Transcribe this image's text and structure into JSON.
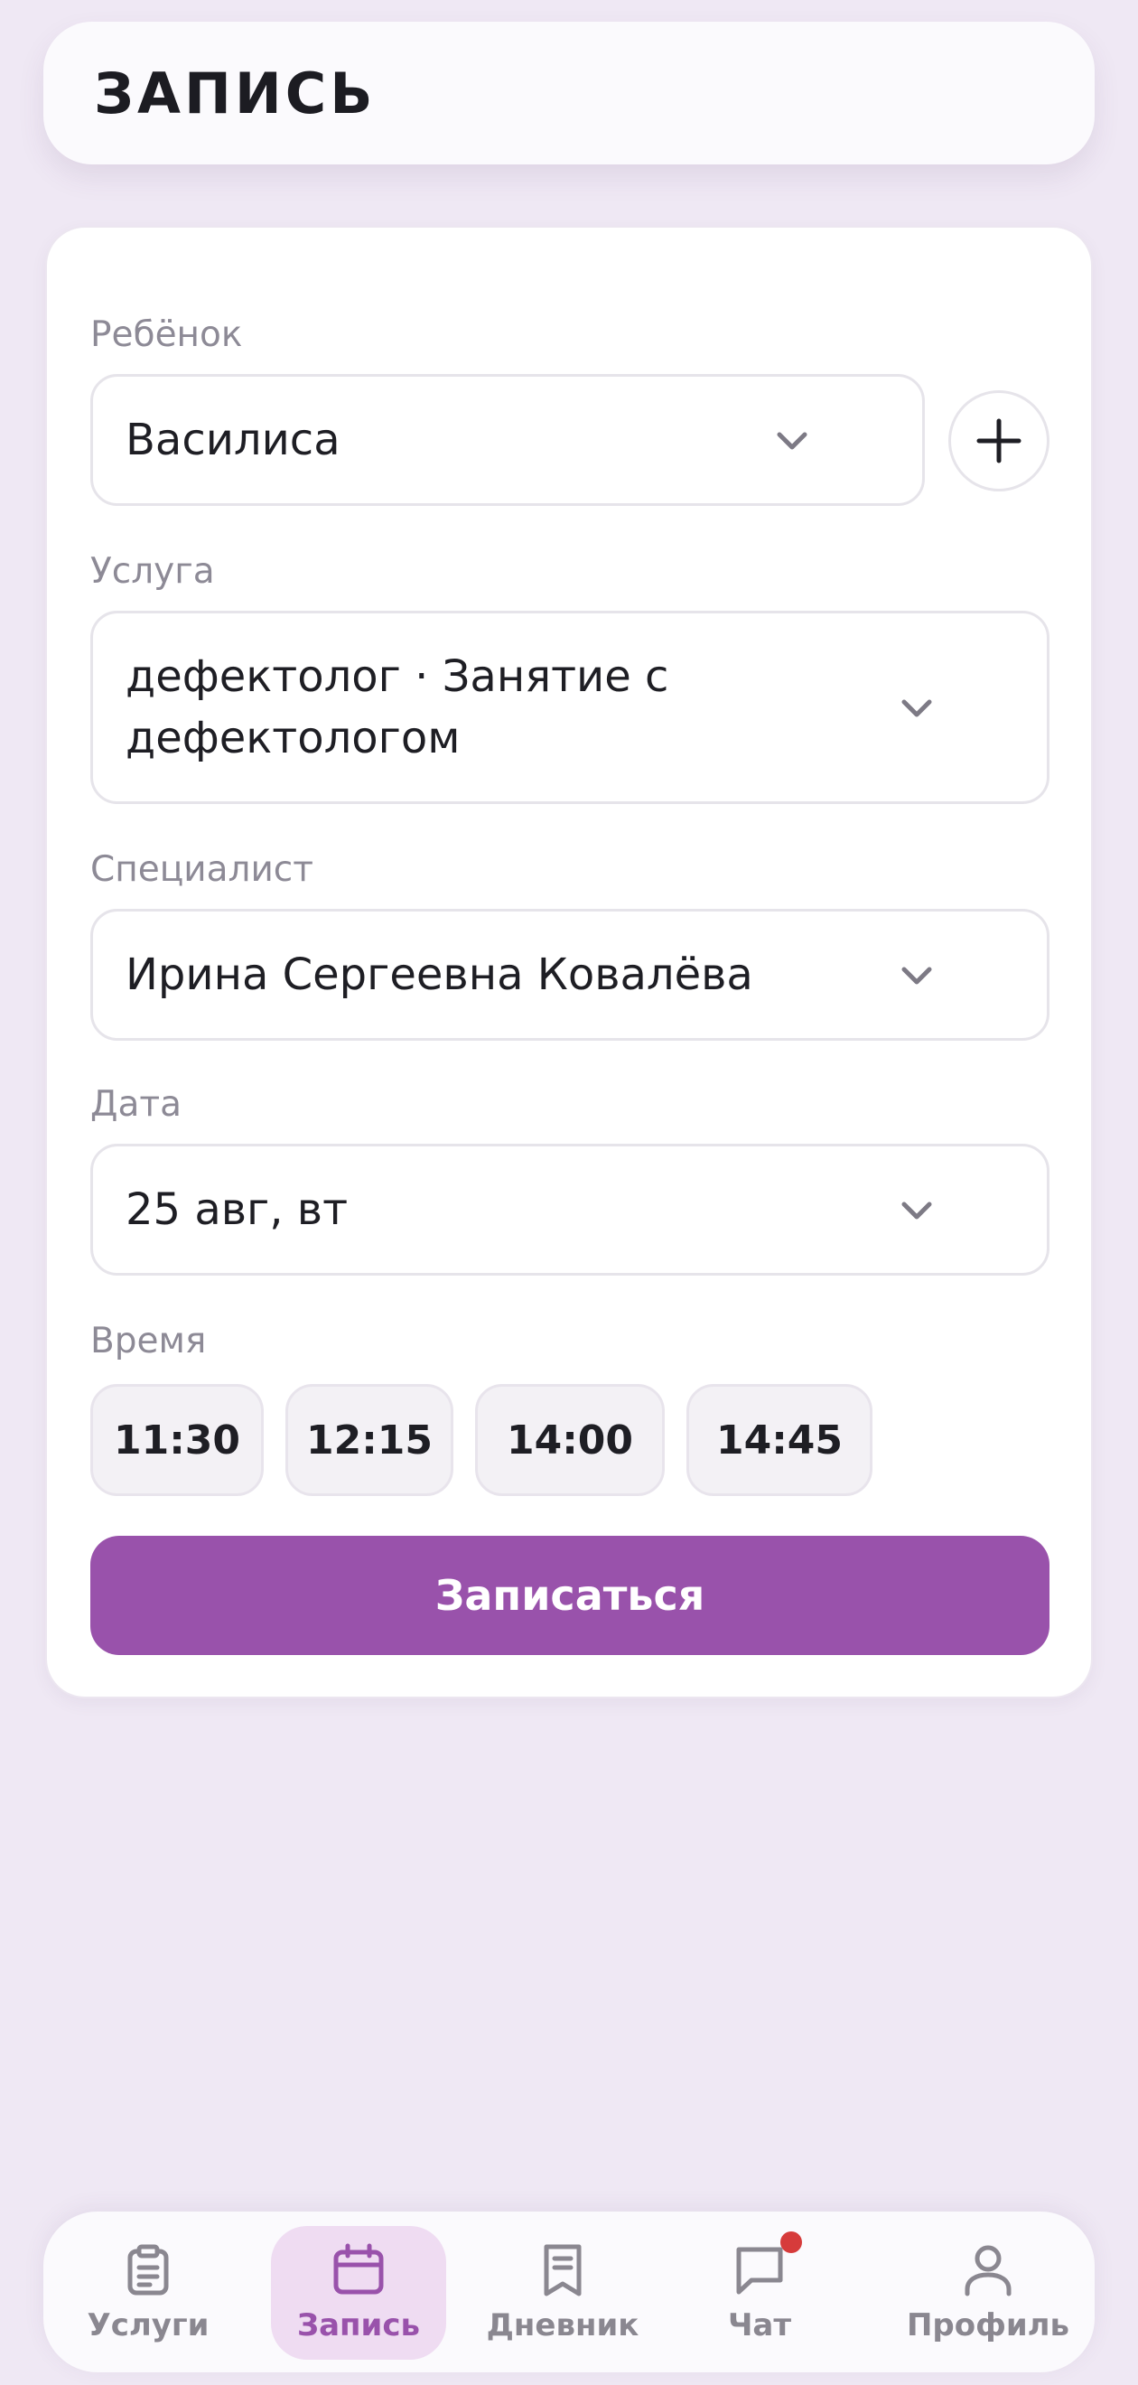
{
  "header": {
    "title": "ЗАПИСЬ"
  },
  "form": {
    "child": {
      "label": "Ребёнок",
      "value": "Василиса"
    },
    "service": {
      "label": "Услуга",
      "value": "дефектолог · Занятие с дефектологом"
    },
    "specialist": {
      "label": "Специалист",
      "value": "Ирина Сергеевна Ковалёва"
    },
    "date": {
      "label": "Дата",
      "value": "25 авг, вт"
    },
    "time": {
      "label": "Время",
      "slots": [
        "11:30",
        "12:15",
        "14:00",
        "14:45"
      ]
    },
    "submit_label": "Записаться"
  },
  "nav": {
    "items": [
      {
        "label": "Услуги",
        "icon": "clipboard-icon"
      },
      {
        "label": "Запись",
        "icon": "calendar-icon",
        "active": true
      },
      {
        "label": "Дневник",
        "icon": "receipt-icon"
      },
      {
        "label": "Чат",
        "icon": "chat-icon",
        "has_notification": true
      },
      {
        "label": "Профиль",
        "icon": "user-icon"
      }
    ]
  },
  "colors": {
    "accent": "#9952ab",
    "active_tab_bg": "#efdcf2",
    "notification": "#d63b3b",
    "background": "#efe8f4"
  }
}
